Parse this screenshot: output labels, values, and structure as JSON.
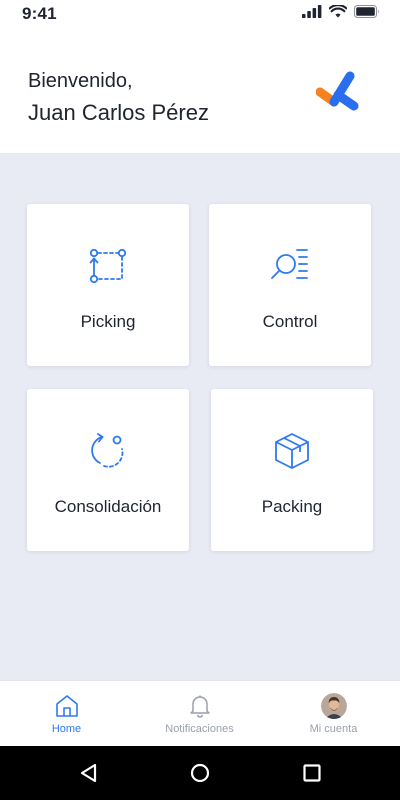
{
  "status_bar": {
    "time": "9:41",
    "icons": [
      "signal-icon",
      "wifi-icon",
      "battery-icon"
    ]
  },
  "header": {
    "greeting": "Bienvenido,",
    "user_name": "Juan Carlos Pérez",
    "logo": "app-logo"
  },
  "modules": [
    {
      "label": "Picking",
      "icon": "picking-route-icon"
    },
    {
      "label": "Control",
      "icon": "control-search-list-icon"
    },
    {
      "label": "Consolidación",
      "icon": "consolidation-cycle-icon"
    },
    {
      "label": "Packing",
      "icon": "package-box-icon"
    }
  ],
  "bottom_nav": {
    "items": [
      {
        "label": "Home",
        "icon": "home-icon",
        "active": true
      },
      {
        "label": "Notificaciones",
        "icon": "bell-icon",
        "active": false
      },
      {
        "label": "Mi cuenta",
        "icon": "avatar",
        "active": false
      }
    ]
  },
  "system_nav": [
    "back-icon",
    "home-circle-icon",
    "recents-icon"
  ],
  "colors": {
    "accent": "#2e79f0",
    "logo_orange": "#f5821f",
    "logo_blue": "#2a6ef0",
    "background": "#e8eaf4",
    "text": "#1f2430",
    "muted": "#9aa0ab"
  }
}
